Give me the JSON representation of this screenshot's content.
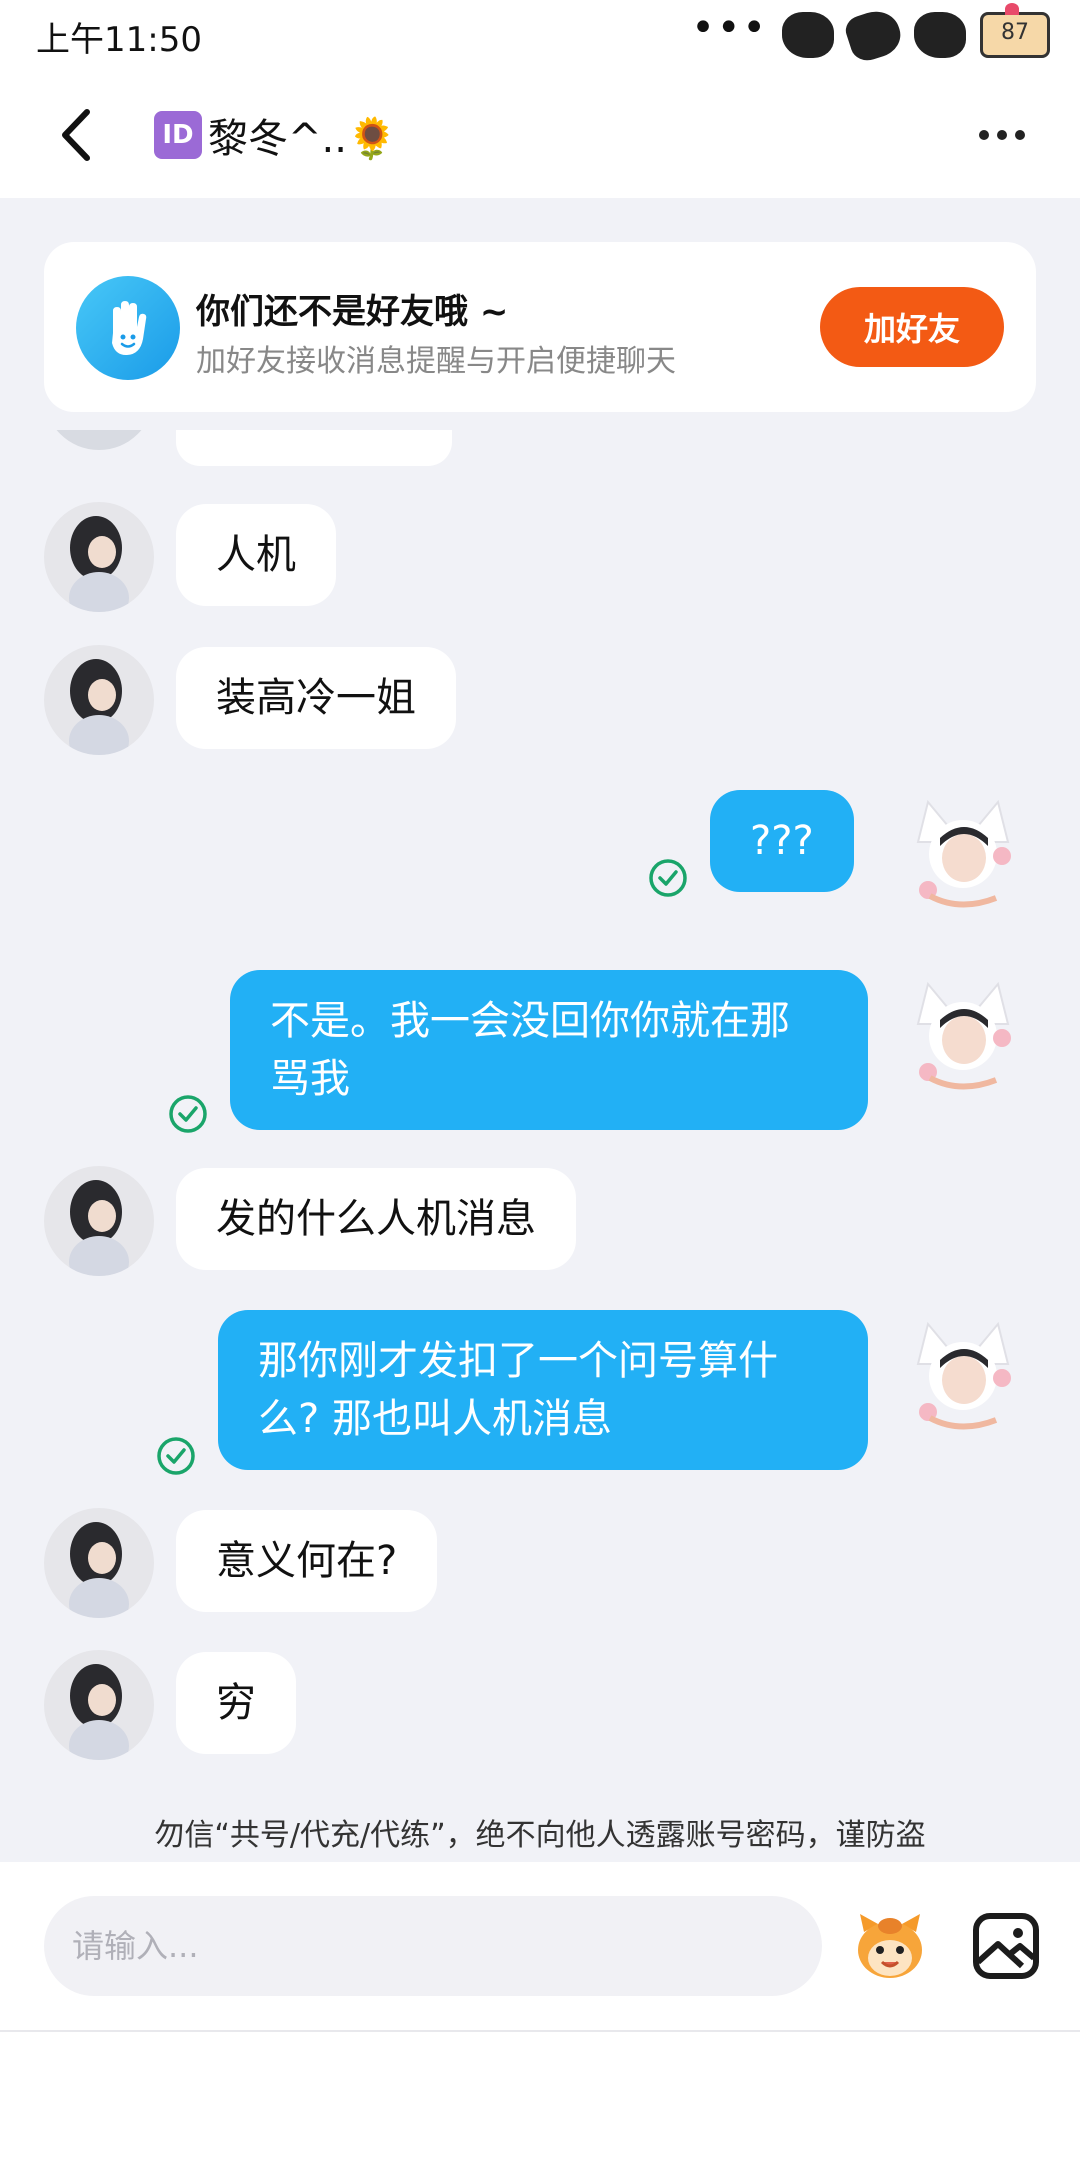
{
  "status_bar": {
    "time": "上午11:50",
    "dots": "•••",
    "battery": "87"
  },
  "header": {
    "id_badge": "ID",
    "title": "黎冬^..🌻"
  },
  "friend_banner": {
    "title": "你们还不是好友哦 ~",
    "subtitle": "加好友接收消息提醒与开启便捷聊天",
    "button": "加好友"
  },
  "messages": [
    {
      "side": "in",
      "text": "人机"
    },
    {
      "side": "in",
      "text": "装高冷一姐"
    },
    {
      "side": "out",
      "text": "???",
      "read": true
    },
    {
      "side": "out",
      "text": "不是。我一会没回你你就在那骂我",
      "read": true
    },
    {
      "side": "in",
      "text": "发的什么人机消息"
    },
    {
      "side": "out",
      "text": "那你刚才发扣了一个问号算什么? 那也叫人机消息",
      "read": true
    },
    {
      "side": "in",
      "text": "意义何在?"
    },
    {
      "side": "in",
      "text": "穷"
    }
  ],
  "warning": "勿信“共号/代充/代练”，绝不向他人透露账号密码，谨防盗",
  "input": {
    "placeholder": "请输入..."
  },
  "colors": {
    "outgoing_bubble": "#22b0f5",
    "add_friend_button": "#f35a14",
    "background": "#f1f2f7"
  },
  "icons": [
    "back-arrow-icon",
    "more-icon",
    "hand-icon",
    "read-check-icon",
    "emoji-icon",
    "image-icon"
  ]
}
